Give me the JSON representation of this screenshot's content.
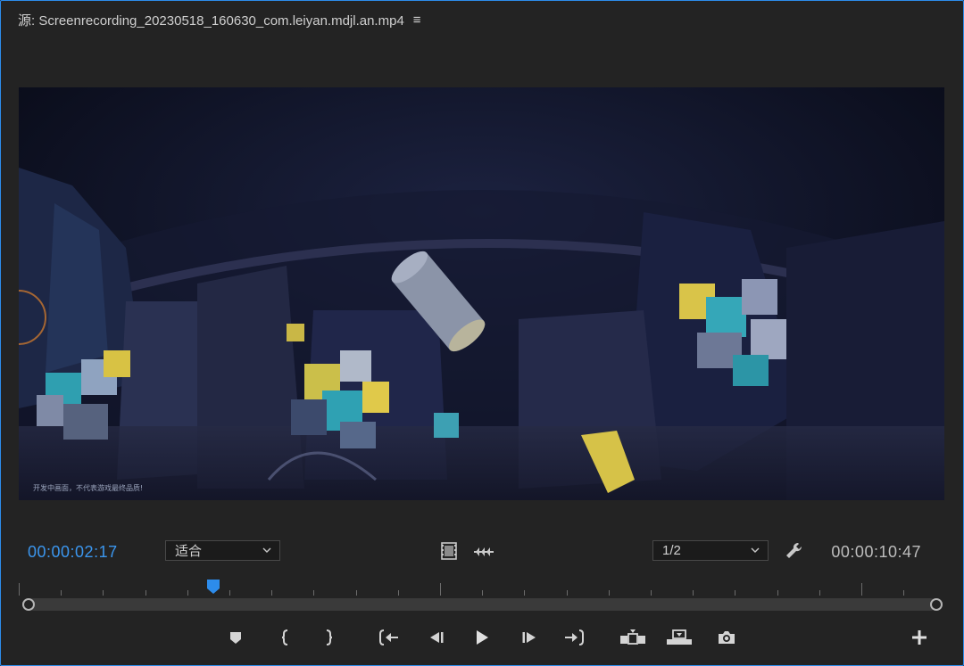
{
  "panel": {
    "title": "源: Screenrecording_20230518_160630_com.leiyan.mdjl.an.mp4",
    "menu_icon": "hamburger-icon"
  },
  "video": {
    "caption": "开发中画面，不代表游戏最终品质!"
  },
  "controls": {
    "current_timecode": "00:00:02:17",
    "duration_timecode": "00:00:10:47",
    "fit_value": "适合",
    "resolution_value": "1/2",
    "playhead_fraction": 0.21
  },
  "colors": {
    "accent": "#2d8ceb",
    "timecode_active": "#3b96ee",
    "background": "#232323"
  },
  "icons": {
    "drag_video": "filmstrip-icon",
    "drag_audio": "audio-waveform-icon",
    "settings": "wrench-icon",
    "marker": "add-marker-icon",
    "mark_in": "mark-in-icon",
    "mark_out": "mark-out-icon",
    "go_to_in": "go-to-in-icon",
    "step_back": "step-back-icon",
    "play": "play-icon",
    "step_forward": "step-forward-icon",
    "go_to_out": "go-to-out-icon",
    "insert": "insert-icon",
    "overwrite": "overwrite-icon",
    "export_frame": "camera-icon",
    "add_button": "plus-icon"
  }
}
